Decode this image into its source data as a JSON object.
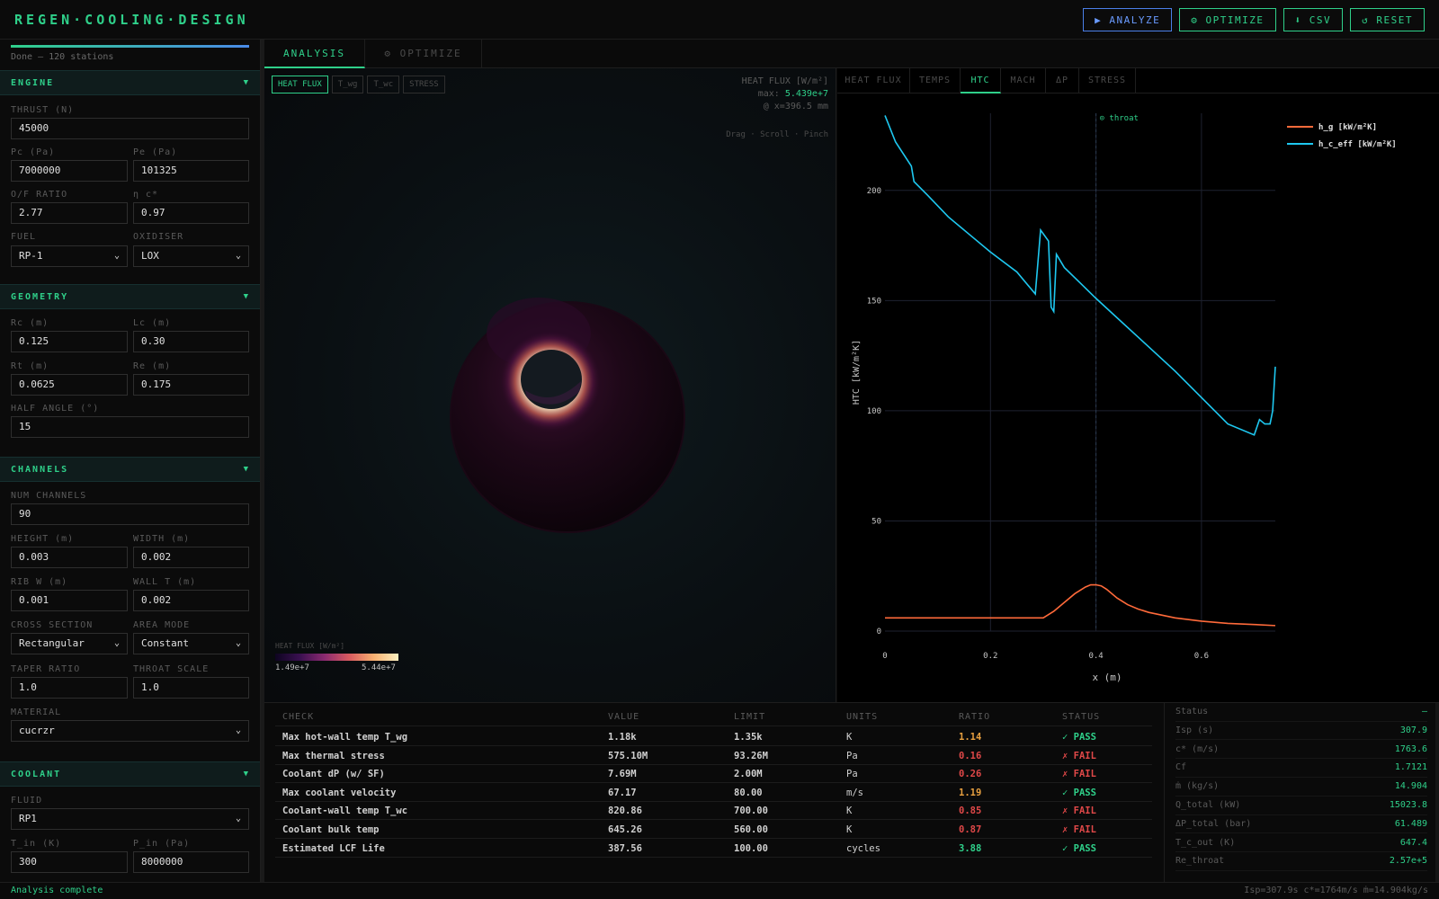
{
  "app": {
    "title": "REGEN·COOLING·DESIGN"
  },
  "toolbar": {
    "analyze": "▶ ANALYZE",
    "optimize": "⚙ OPTIMIZE",
    "csv": "⬇ CSV",
    "reset": "↺ RESET"
  },
  "sidebar": {
    "progress": 1.0,
    "progress_text": "Done — 120 stations",
    "engine": {
      "title": "ENGINE",
      "thrust_label": "THRUST (N)",
      "thrust": "45000",
      "pc_label": "Pc (Pa)",
      "pc": "7000000",
      "pe_label": "Pe (Pa)",
      "pe": "101325",
      "of_label": "O/F RATIO",
      "of": "2.77",
      "eta_label": "η c*",
      "eta": "0.97",
      "fuel_label": "FUEL",
      "fuel": "RP-1",
      "ox_label": "OXIDISER",
      "ox": "LOX"
    },
    "geometry": {
      "title": "GEOMETRY",
      "rc_label": "Rc (m)",
      "rc": "0.125",
      "lc_label": "Lc (m)",
      "lc": "0.30",
      "rt_label": "Rt (m)",
      "rt": "0.0625",
      "re_label": "Re (m)",
      "re": "0.175",
      "half_label": "HALF ANGLE (°)",
      "half": "15"
    },
    "channels": {
      "title": "CHANNELS",
      "num_label": "NUM CHANNELS",
      "num": "90",
      "height_label": "HEIGHT (m)",
      "height": "0.003",
      "width_label": "WIDTH (m)",
      "width": "0.002",
      "rib_label": "RIB W (m)",
      "rib": "0.001",
      "wall_label": "WALL T (m)",
      "wall": "0.002",
      "cross_label": "CROSS SECTION",
      "cross": "Rectangular",
      "area_label": "AREA MODE",
      "area": "Constant",
      "taper_label": "TAPER RATIO",
      "taper": "1.0",
      "throat_label": "THROAT SCALE",
      "throat": "1.0",
      "material_label": "MATERIAL",
      "material": "cucrzr"
    },
    "coolant": {
      "title": "COOLANT",
      "fluid_label": "FLUID",
      "fluid": "RP1",
      "tin_label": "T_in (K)",
      "tin": "300",
      "pin_label": "P_in (Pa)",
      "pin": "8000000"
    }
  },
  "main_tabs": [
    "ANALYSIS",
    "⚙ OPTIMIZE"
  ],
  "viewport": {
    "buttons": [
      "HEAT FLUX",
      "T_wg",
      "T_wc",
      "STRESS"
    ],
    "info_title": "HEAT FLUX [W/m²]",
    "info_max_label": "max:",
    "info_max": "5.439e+7",
    "info_at": "@ x=396.5 mm",
    "hint": "Drag · Scroll · Pinch",
    "colorbar_label": "HEAT FLUX [W/m²]",
    "colorbar_min": "1.49e+7",
    "colorbar_max": "5.44e+7"
  },
  "chart_tabs": [
    "HEAT FLUX",
    "TEMPS",
    "HTC",
    "MACH",
    "ΔP",
    "STRESS"
  ],
  "chart_data": {
    "type": "line",
    "xlabel": "x (m)",
    "ylabel": "HTC [kW/m²K]",
    "xlim": [
      0,
      0.74
    ],
    "ylim": [
      0,
      235
    ],
    "xticks": [
      "0",
      "0.2",
      "0.4",
      "0.6"
    ],
    "yticks": [
      "0",
      "50",
      "100",
      "150",
      "200"
    ],
    "annotation": "⊙ throat",
    "throat_x": 0.4,
    "series": [
      {
        "name": "h_g [kW/m²K]",
        "color": "#ff6a3a",
        "x": [
          0,
          0.05,
          0.1,
          0.15,
          0.2,
          0.25,
          0.3,
          0.32,
          0.34,
          0.36,
          0.38,
          0.39,
          0.4,
          0.41,
          0.42,
          0.44,
          0.46,
          0.48,
          0.5,
          0.55,
          0.6,
          0.65,
          0.7,
          0.74
        ],
        "y": [
          6,
          6,
          6,
          6,
          6,
          6,
          6,
          9,
          13,
          17,
          20,
          21,
          21,
          20.5,
          19,
          15,
          12,
          10,
          8.5,
          6,
          4.5,
          3.5,
          3,
          2.5
        ]
      },
      {
        "name": "h_c_eff [kW/m²K]",
        "color": "#1ec8f0",
        "x": [
          0,
          0.02,
          0.05,
          0.055,
          0.08,
          0.12,
          0.16,
          0.2,
          0.25,
          0.285,
          0.295,
          0.31,
          0.315,
          0.32,
          0.325,
          0.34,
          0.37,
          0.4,
          0.45,
          0.5,
          0.55,
          0.6,
          0.65,
          0.7,
          0.71,
          0.72,
          0.73,
          0.735,
          0.74
        ],
        "y": [
          234,
          222,
          211,
          204,
          198,
          188,
          180,
          172,
          163,
          153,
          182,
          177,
          147,
          145,
          171,
          165,
          158,
          151,
          140,
          129,
          118,
          106,
          94,
          89,
          96,
          94,
          94,
          100,
          120
        ]
      }
    ]
  },
  "checks": {
    "headers": [
      "CHECK",
      "VALUE",
      "LIMIT",
      "UNITS",
      "RATIO",
      "STATUS"
    ],
    "rows": [
      {
        "check": "Max hot-wall temp T_wg",
        "value": "1.18k",
        "limit": "1.35k",
        "units": "K",
        "ratio": "1.14",
        "ratio_cls": "warn",
        "status": "✓ PASS",
        "status_cls": "ok"
      },
      {
        "check": "Max thermal stress",
        "value": "575.10M",
        "limit": "93.26M",
        "units": "Pa",
        "ratio": "0.16",
        "ratio_cls": "bad",
        "status": "✗ FAIL",
        "status_cls": "bad"
      },
      {
        "check": "Coolant dP (w/ SF)",
        "value": "7.69M",
        "limit": "2.00M",
        "units": "Pa",
        "ratio": "0.26",
        "ratio_cls": "bad",
        "status": "✗ FAIL",
        "status_cls": "bad"
      },
      {
        "check": "Max coolant velocity",
        "value": "67.17",
        "limit": "80.00",
        "units": "m/s",
        "ratio": "1.19",
        "ratio_cls": "warn",
        "status": "✓ PASS",
        "status_cls": "ok"
      },
      {
        "check": "Coolant-wall temp T_wc",
        "value": "820.86",
        "limit": "700.00",
        "units": "K",
        "ratio": "0.85",
        "ratio_cls": "bad",
        "status": "✗ FAIL",
        "status_cls": "bad"
      },
      {
        "check": "Coolant bulk temp",
        "value": "645.26",
        "limit": "560.00",
        "units": "K",
        "ratio": "0.87",
        "ratio_cls": "bad",
        "status": "✗ FAIL",
        "status_cls": "bad"
      },
      {
        "check": "Estimated LCF Life",
        "value": "387.56",
        "limit": "100.00",
        "units": "cycles",
        "ratio": "3.88",
        "ratio_cls": "ok",
        "status": "✓ PASS",
        "status_cls": "ok"
      }
    ]
  },
  "status_panel": [
    {
      "k": "Status",
      "v": "—"
    },
    {
      "k": "Isp (s)",
      "v": "307.9"
    },
    {
      "k": "c* (m/s)",
      "v": "1763.6"
    },
    {
      "k": "Cf",
      "v": "1.7121"
    },
    {
      "k": "ṁ (kg/s)",
      "v": "14.904"
    },
    {
      "k": "Q_total (kW)",
      "v": "15023.8"
    },
    {
      "k": "ΔP_total (bar)",
      "v": "61.489"
    },
    {
      "k": "T_c_out (K)",
      "v": "647.4"
    },
    {
      "k": "Re_throat",
      "v": "2.57e+5"
    }
  ],
  "statusbar": {
    "left": "Analysis complete",
    "right": "Isp=307.9s c*=1764m/s ṁ=14.904kg/s"
  }
}
